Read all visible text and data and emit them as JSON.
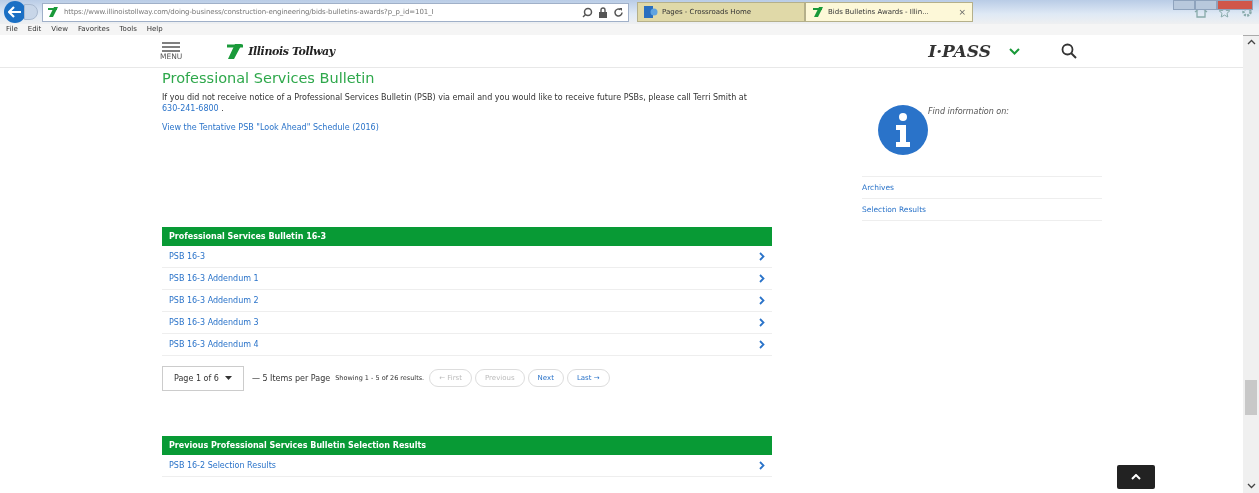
{
  "browser": {
    "address": "https://www.illinoistollway.com/doing-business/construction-engineering/bids-bulletins-awards?p_p_id=101_I",
    "tabs": [
      {
        "label": "Pages - Crossroads Home",
        "selected": false,
        "kind": "sharepoint"
      },
      {
        "label": "Bids Bulletins Awards - Illin...",
        "selected": true,
        "kind": "tollway",
        "close": "×"
      }
    ],
    "menu": [
      "File",
      "Edit",
      "View",
      "Favorites",
      "Tools",
      "Help"
    ]
  },
  "header": {
    "menu_label": "MENU",
    "logo_text": "Illinois Tollway",
    "ipass": "I·PASS"
  },
  "content": {
    "title": "Professional Services Bulletin",
    "intro": "If you did not receive notice of a Professional Services Bulletin (PSB) via email and you would like to receive future PSBs, please call Terri Smith at ",
    "phone": "630-241-6800",
    "intro_end": " .",
    "schedule_link": "View the Tentative PSB \"Look Ahead\" Schedule (2016)"
  },
  "sidebar": {
    "heading": "Find information on:",
    "links": [
      "Archives",
      "Selection Results"
    ]
  },
  "bulletin_table": {
    "title": "Professional Services Bulletin 16-3",
    "rows": [
      "PSB 16-3",
      "PSB 16-3 Addendum 1",
      "PSB 16-3 Addendum 2",
      "PSB 16-3 Addendum 3",
      "PSB 16-3 Addendum 4"
    ]
  },
  "pagination": {
    "page_select": "Page 1 of 6",
    "per_page": "— 5 Items per Page",
    "showing": "Showing 1 - 5 of 26 results.",
    "buttons": [
      {
        "label": "← First",
        "disabled": true
      },
      {
        "label": "Previous",
        "disabled": true
      },
      {
        "label": "Next",
        "disabled": false
      },
      {
        "label": "Last →",
        "disabled": false
      }
    ]
  },
  "results_table": {
    "title": "Previous Professional Services Bulletin Selection Results",
    "rows": [
      "PSB 16-2 Selection Results"
    ]
  }
}
